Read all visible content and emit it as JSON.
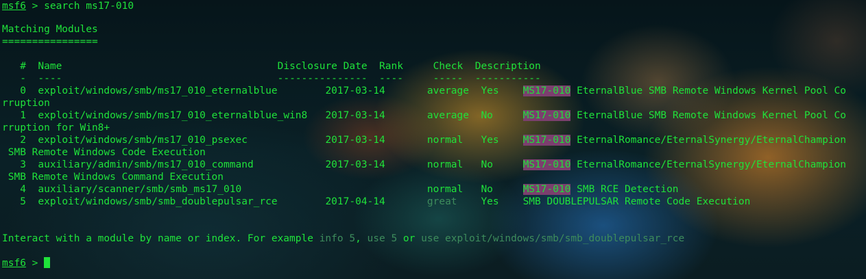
{
  "command": {
    "prompt": "msf6",
    "arrow": ">",
    "text": "search ms17-010"
  },
  "section": {
    "title": "Matching Modules",
    "underline": "================"
  },
  "table": {
    "headers": {
      "num": "#",
      "name": "Name",
      "date": "Disclosure Date",
      "rank": "Rank",
      "check": "Check",
      "description": "Description"
    },
    "separators": {
      "num": "-",
      "name": "----",
      "date": "---------------",
      "rank": "----",
      "check": "-----",
      "description": "-----------"
    },
    "rows": [
      {
        "num": "0",
        "name": "exploit/windows/smb/ms17_010_eternalblue",
        "date": "2017-03-14",
        "rank": "average",
        "check": "Yes",
        "desc_match": "MS17-010",
        "desc_rest": " EternalBlue SMB Remote Windows Kernel Pool Co",
        "wrap": "rruption"
      },
      {
        "num": "1",
        "name": "exploit/windows/smb/ms17_010_eternalblue_win8",
        "date": "2017-03-14",
        "rank": "average",
        "check": "No",
        "desc_match": "MS17-010",
        "desc_rest": " EternalBlue SMB Remote Windows Kernel Pool Co",
        "wrap": "rruption for Win8+"
      },
      {
        "num": "2",
        "name": "exploit/windows/smb/ms17_010_psexec",
        "date": "2017-03-14",
        "rank": "normal",
        "check": "Yes",
        "desc_match": "MS17-010",
        "desc_rest": " EternalRomance/EternalSynergy/EternalChampion",
        "wrap": " SMB Remote Windows Code Execution"
      },
      {
        "num": "3",
        "name": "auxiliary/admin/smb/ms17_010_command",
        "date": "2017-03-14",
        "rank": "normal",
        "check": "No",
        "desc_match": "MS17-010",
        "desc_rest": " EternalRomance/EternalSynergy/EternalChampion",
        "wrap": " SMB Remote Windows Command Execution"
      },
      {
        "num": "4",
        "name": "auxiliary/scanner/smb/smb_ms17_010",
        "date": "",
        "rank": "normal",
        "check": "No",
        "desc_match": "MS17-010",
        "desc_rest": " SMB RCE Detection",
        "wrap": ""
      },
      {
        "num": "5",
        "name": "exploit/windows/smb/smb_doublepulsar_rce",
        "date": "2017-04-14",
        "rank": "great",
        "check": "Yes",
        "desc_match": "",
        "desc_rest": "SMB DOUBLEPULSAR Remote Code Execution",
        "wrap": ""
      }
    ]
  },
  "hint": {
    "prefix": "Interact with a module by name or index. For example ",
    "example1": "info 5",
    "sep1": ", ",
    "example2": "use 5",
    "sep2": " or ",
    "example3": "use exploit/windows/smb/smb_doublepulsar_rce"
  },
  "final_prompt": {
    "prompt": "msf6",
    "arrow": ">"
  },
  "colors": {
    "text": "#1fe23a",
    "faded": "#3d8c5c",
    "highlight": "#7b3f6e"
  }
}
